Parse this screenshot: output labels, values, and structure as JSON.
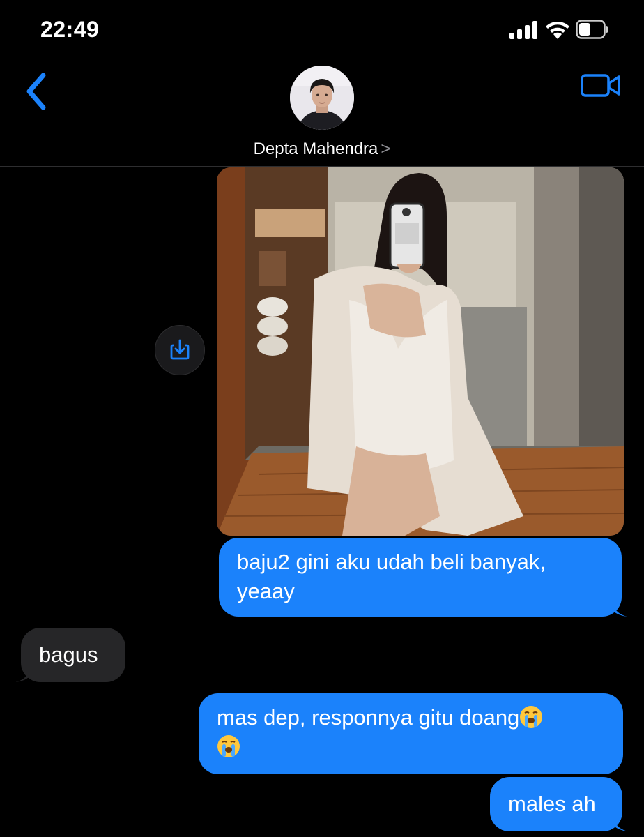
{
  "status": {
    "time": "22:49"
  },
  "header": {
    "contact_name": "Depta Mahendra",
    "chevron": ">"
  },
  "icons": {
    "back": "chevron-left-icon",
    "video": "video-camera-icon",
    "save": "download-icon",
    "emoji": "loudly-crying-face"
  },
  "messages": [
    {
      "from": "me",
      "type": "image"
    },
    {
      "from": "me",
      "type": "text",
      "text": "baju2 gini aku udah beli banyak, yeaay"
    },
    {
      "from": "them",
      "type": "text",
      "text": "bagus"
    },
    {
      "from": "me",
      "type": "text",
      "text": "mas dep, responnya gitu doang",
      "emoji_count": 2
    },
    {
      "from": "me",
      "type": "text",
      "text": "males ah"
    }
  ],
  "colors": {
    "accent": "#1b82fb",
    "received_bubble": "#262628",
    "background": "#000000"
  }
}
